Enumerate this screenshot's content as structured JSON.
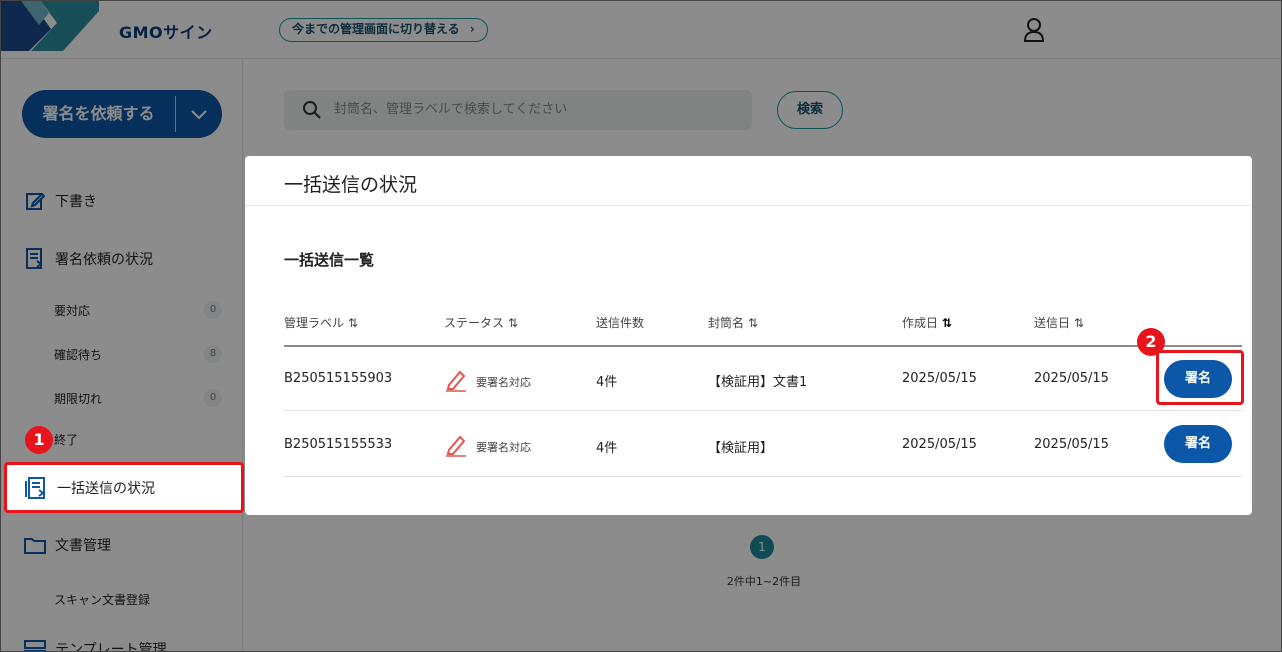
{
  "header": {
    "brand": "GMOサイン",
    "switch_label": "今までの管理画面に切り替える",
    "switch_chevron": "chevron-right-icon",
    "user_icon": "user-icon"
  },
  "sidebar": {
    "request_button": "署名を依頼する",
    "items": [
      {
        "label": "下書き",
        "icon": "edit-icon"
      },
      {
        "label": "署名依頼の状況",
        "icon": "document-list-icon"
      },
      {
        "label": "一括送信の状況",
        "icon": "bulk-send-icon"
      },
      {
        "label": "文書管理",
        "icon": "folder-icon"
      },
      {
        "label": "テンプレート管理",
        "icon": "template-icon"
      }
    ],
    "sub_items": [
      {
        "label": "要対応",
        "count": "0"
      },
      {
        "label": "確認待ち",
        "count": "8"
      },
      {
        "label": "期限切れ",
        "count": "0"
      },
      {
        "label": "終了",
        "count": ""
      }
    ],
    "scan_item": "スキャン文書登録"
  },
  "search": {
    "placeholder": "封筒名、管理ラベルで検索してください",
    "button": "検索"
  },
  "pager": {
    "current": "1",
    "summary": "2件中1~2件目"
  },
  "modal": {
    "title": "一括送信の状況",
    "subtitle": "一括送信一覧",
    "columns": [
      "管理ラベル",
      "ステータス",
      "送信件数",
      "封筒名",
      "作成日",
      "送信日"
    ],
    "rows": [
      {
        "label": "B250515155903",
        "status": "要署名対応",
        "count": "4件",
        "envelope": "【検証用】文書1",
        "created": "2025/05/15",
        "sent": "2025/05/15",
        "action": "署名"
      },
      {
        "label": "B250515155533",
        "status": "要署名対応",
        "count": "4件",
        "envelope": "【検証用】",
        "created": "2025/05/15",
        "sent": "2025/05/15",
        "action": "署名"
      }
    ]
  },
  "annotations": {
    "step1": "1",
    "step2": "2"
  },
  "colors": {
    "primary": "#0d57a8",
    "accent_teal": "#1a9a9a",
    "highlight_red": "#e8141c"
  }
}
